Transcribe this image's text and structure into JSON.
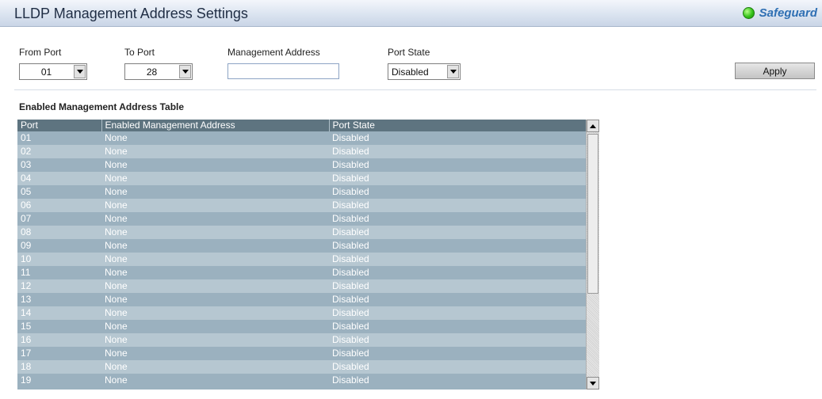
{
  "header": {
    "title": "LLDP Management Address Settings",
    "safeguard_label": "Safeguard"
  },
  "form": {
    "from_port_label": "From Port",
    "from_port_value": "01",
    "to_port_label": "To Port",
    "to_port_value": "28",
    "mgmt_address_label": "Management Address",
    "mgmt_address_value": "",
    "port_state_label": "Port State",
    "port_state_value": "Disabled",
    "apply_label": "Apply"
  },
  "table": {
    "section_title": "Enabled Management Address Table",
    "columns": [
      "Port",
      "Enabled Management Address",
      "Port State"
    ],
    "rows": [
      [
        "01",
        "None",
        "Disabled"
      ],
      [
        "02",
        "None",
        "Disabled"
      ],
      [
        "03",
        "None",
        "Disabled"
      ],
      [
        "04",
        "None",
        "Disabled"
      ],
      [
        "05",
        "None",
        "Disabled"
      ],
      [
        "06",
        "None",
        "Disabled"
      ],
      [
        "07",
        "None",
        "Disabled"
      ],
      [
        "08",
        "None",
        "Disabled"
      ],
      [
        "09",
        "None",
        "Disabled"
      ],
      [
        "10",
        "None",
        "Disabled"
      ],
      [
        "11",
        "None",
        "Disabled"
      ],
      [
        "12",
        "None",
        "Disabled"
      ],
      [
        "13",
        "None",
        "Disabled"
      ],
      [
        "14",
        "None",
        "Disabled"
      ],
      [
        "15",
        "None",
        "Disabled"
      ],
      [
        "16",
        "None",
        "Disabled"
      ],
      [
        "17",
        "None",
        "Disabled"
      ],
      [
        "18",
        "None",
        "Disabled"
      ],
      [
        "19",
        "None",
        "Disabled"
      ]
    ]
  },
  "icons": {
    "status": "green-led-icon",
    "select_arrow": "chevron-down-icon",
    "scroll_up": "arrow-up-icon",
    "scroll_down": "arrow-down-icon"
  },
  "colors": {
    "header_row": "#5e7480",
    "row_odd": "#9bb1bf",
    "row_even": "#b6c7d1",
    "led": "#35c21a"
  }
}
